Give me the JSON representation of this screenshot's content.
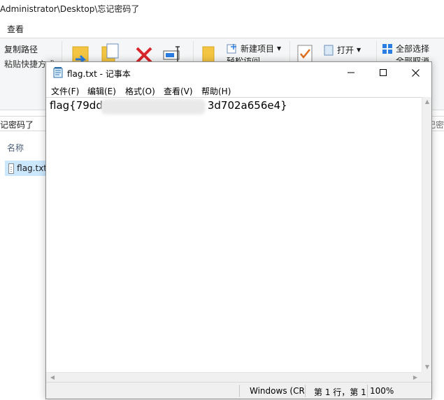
{
  "explorer": {
    "title_path": "Administrator\\Desktop\\忘记密码了",
    "menu_tab": "查看",
    "ribbon": {
      "copy_path": "复制路径",
      "paste_shortcut": "粘贴快捷方式",
      "new_item": "新建项目",
      "easy_access": "轻松访问",
      "open": "打开",
      "select_all": "全部选择",
      "select_none": "全部取消"
    },
    "address_crumb": "记密码了",
    "search_hint": "记密",
    "column_name": "名称",
    "file_name": "flag.txt"
  },
  "notepad": {
    "title": "flag.txt - 记事本",
    "menus": [
      "文件(F)",
      "编辑(E)",
      "格式(O)",
      "查看(V)",
      "帮助(H)"
    ],
    "content_start": "flag{79dd",
    "content_end": "3d702a656e4}",
    "status": {
      "encoding": "Windows (CR",
      "position": "第 1 行，第 1",
      "zoom": "100%"
    }
  }
}
